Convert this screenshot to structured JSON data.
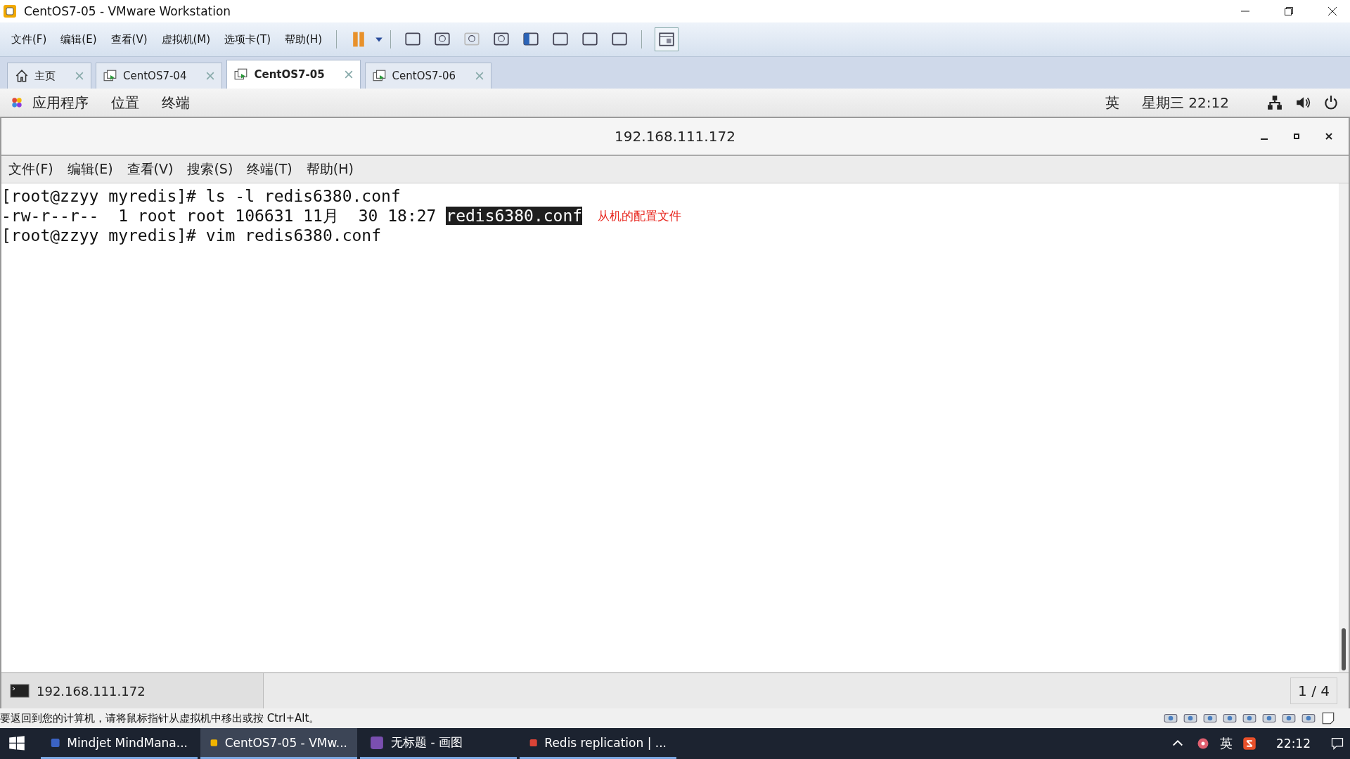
{
  "window": {
    "title": "CentOS7-05 - VMware Workstation"
  },
  "menu": [
    "文件(F)",
    "编辑(E)",
    "查看(V)",
    "虚拟机(M)",
    "选项卡(T)",
    "帮助(H)"
  ],
  "tabs": [
    {
      "label": "主页",
      "kind": "home",
      "selected": false
    },
    {
      "label": "CentOS7-04",
      "kind": "vm",
      "selected": false
    },
    {
      "label": "CentOS7-05",
      "kind": "vm",
      "selected": true
    },
    {
      "label": "CentOS7-06",
      "kind": "vm",
      "selected": false
    }
  ],
  "gnome_bar": {
    "items": [
      "应用程序",
      "位置",
      "终端"
    ],
    "input_method": "英",
    "clock": "星期三 22:12"
  },
  "terminal": {
    "title": "192.168.111.172",
    "menu": [
      "文件(F)",
      "编辑(E)",
      "查看(V)",
      "搜索(S)",
      "终端(T)",
      "帮助(H)"
    ],
    "lines": [
      {
        "segments": [
          {
            "text": "[root@zzyy myredis]# ls -l redis6380.conf",
            "highlighted": false
          }
        ]
      },
      {
        "segments": [
          {
            "text": "-rw-r--r--  1 root root 106631 11月  30 18:27 ",
            "highlighted": false
          },
          {
            "text": "redis6380.conf",
            "highlighted": true
          }
        ],
        "annotation": "从机的配置文件"
      },
      {
        "segments": [
          {
            "text": "[root@zzyy myredis]# vim redis6380.conf",
            "highlighted": false
          }
        ]
      }
    ],
    "tab_label": "192.168.111.172",
    "page": "1 / 4"
  },
  "status_bar": {
    "message": "要返回到您的计算机，请将鼠标指针从虚拟机中移出或按 Ctrl+Alt。"
  },
  "taskbar": {
    "items": [
      {
        "label": "Mindjet MindMana...",
        "selected": false
      },
      {
        "label": "CentOS7-05 - VMw...",
        "selected": true
      },
      {
        "label": "无标题 - 画图",
        "selected": false
      },
      {
        "label": "Redis replication | ...",
        "selected": false
      }
    ],
    "input_method": "英",
    "clock": "22:12"
  }
}
